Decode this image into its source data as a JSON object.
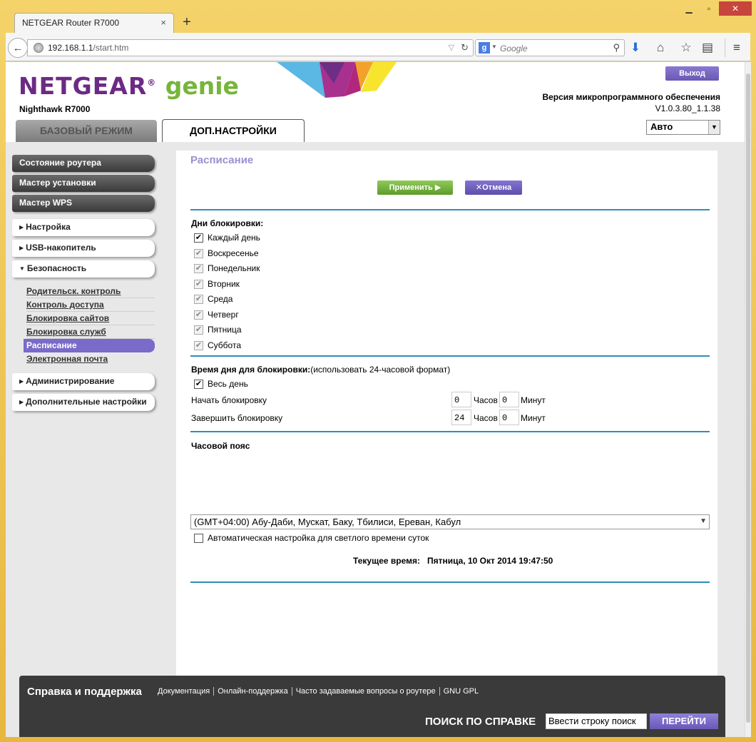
{
  "browser": {
    "tab_title": "NETGEAR Router R7000",
    "tab_close": "×",
    "new_tab": "+",
    "url_host": "192.168.1.1",
    "url_path": "/start.htm",
    "search_placeholder": "Google",
    "search_engine_letter": "g"
  },
  "header": {
    "brand": "NETGEAR",
    "brand_reg": "®",
    "brand_genie": "genie",
    "model": "Nighthawk R7000",
    "logout_label": "Выход",
    "firmware_label": "Версия микропрограммного обеспечения",
    "firmware_version": "V1.0.3.80_1.1.38",
    "tab_basic": "БАЗОВЫЙ РЕЖИМ",
    "tab_advanced": "ДОП.НАСТРОЙКИ",
    "language_value": "Авто",
    "colors": {
      "purple": "#6c2a84",
      "green": "#76b53a",
      "deco_blue": "#5bb7e3",
      "deco_orange": "#f2a22a",
      "deco_yellow": "#f7e42f",
      "deco_magenta": "#b0287c"
    }
  },
  "sidebar": {
    "top_buttons": [
      "Состояние роутера",
      "Мастер установки",
      "Мастер WPS"
    ],
    "setup": "Настройка",
    "usb": "USB-накопитель",
    "security": "Безопасность",
    "security_items": [
      "Родительск. контроль",
      "Контроль доступа",
      "Блокировка сайтов",
      "Блокировка служб",
      "Расписание",
      "Электронная почта"
    ],
    "active_item": "Расписание",
    "admin": "Администрирование",
    "advanced": "Дополнительные настройки"
  },
  "content": {
    "title": "Расписание",
    "apply_label": "Применить",
    "apply_icon": "▶",
    "cancel_label": "Отмена",
    "cancel_icon": "✕",
    "days_heading": "Дни блокировки:",
    "every_day": "Каждый день",
    "days": [
      "Воскресенье",
      "Понедельник",
      "Вторник",
      "Среда",
      "Четверг",
      "Пятница",
      "Суббота"
    ],
    "time_heading": "Время дня для блокировки:",
    "time_heading_note": "(использовать 24-часовой формат)",
    "all_day": "Весь день",
    "start_label": "Начать блокировку",
    "end_label": "Завершить блокировку",
    "start_hour": "0",
    "start_min": "0",
    "end_hour": "24",
    "end_min": "0",
    "hours_unit": "Часов",
    "minutes_unit": "Минут",
    "tz_heading": "Часовой пояс",
    "tz_value": "(GMT+04:00) Абу-Даби, Мускат, Баку, Тбилиси, Ереван, Кабул",
    "dst_label": "Автоматическая настройка для светлого времени суток",
    "current_time_label": "Текущее время:",
    "current_time_value": "Пятница, 10 Окт 2014 19:47:50",
    "checked_mark": "✔"
  },
  "footer": {
    "title": "Справка и поддержка",
    "links": [
      "Документация",
      "Онлайн-поддержка",
      "Часто задаваемые вопросы о роутере",
      "GNU GPL"
    ],
    "search_label": "ПОИСК ПО СПРАВКЕ",
    "search_value": "Ввести строку поиск",
    "go_label": "ПЕРЕЙТИ"
  }
}
